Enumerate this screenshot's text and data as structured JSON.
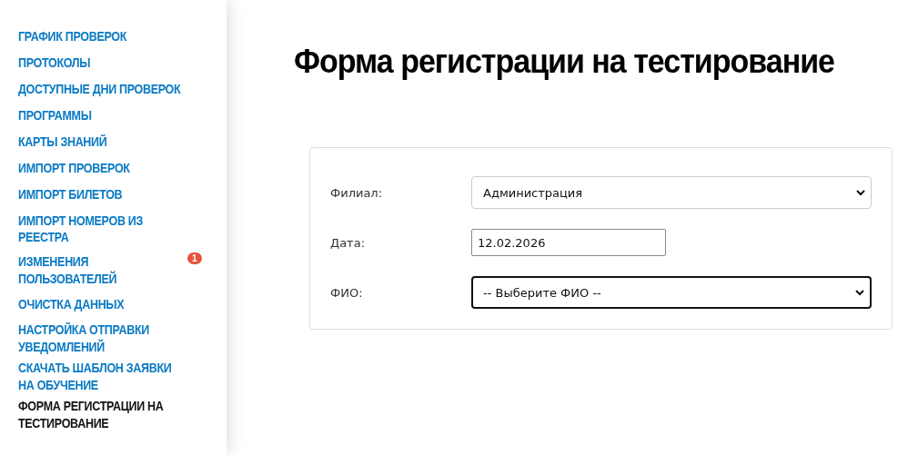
{
  "sidebar": {
    "items": [
      {
        "label": "ГРАФИК ПРОВЕРОК",
        "selected": false
      },
      {
        "label": "ПРОТОКОЛЫ",
        "selected": false
      },
      {
        "label": "ДОСТУПНЫЕ ДНИ ПРОВЕРОК",
        "selected": false
      },
      {
        "label": "ПРОГРАММЫ",
        "selected": false
      },
      {
        "label": "КАРТЫ ЗНАНИЙ",
        "selected": false
      },
      {
        "label": "ИМПОРТ ПРОВЕРОК",
        "selected": false
      },
      {
        "label": "ИМПОРТ БИЛЕТОВ",
        "selected": false
      },
      {
        "label": "ИМПОРТ НОМЕРОВ ИЗ РЕЕСТРА",
        "selected": false
      },
      {
        "label": "ИЗМЕНЕНИЯ ПОЛЬЗОВАТЕЛЕЙ",
        "selected": false,
        "badge": "1"
      },
      {
        "label": "ОЧИСТКА ДАННЫХ",
        "selected": false
      },
      {
        "label": "НАСТРОЙКА ОТПРАВКИ УВЕДОМЛЕНИЙ",
        "selected": false
      },
      {
        "label": "СКАЧАТЬ ШАБЛОН ЗАЯВКИ НА ОБУЧЕНИЕ",
        "selected": false
      },
      {
        "label": "ФОРМА РЕГИСТРАЦИИ НА ТЕСТИРОВАНИЕ",
        "selected": true
      }
    ]
  },
  "page": {
    "title": "Форма регистрации на тестирование"
  },
  "form": {
    "fields": [
      {
        "kind": "select",
        "label": "Филиал:",
        "value": "Администрация",
        "focused": false
      },
      {
        "kind": "date",
        "label": "Дата:",
        "value": "12.02.2026",
        "focused": false
      },
      {
        "kind": "select",
        "label": "ФИО:",
        "value": "-- Выберите ФИО --",
        "focused": true
      }
    ]
  }
}
